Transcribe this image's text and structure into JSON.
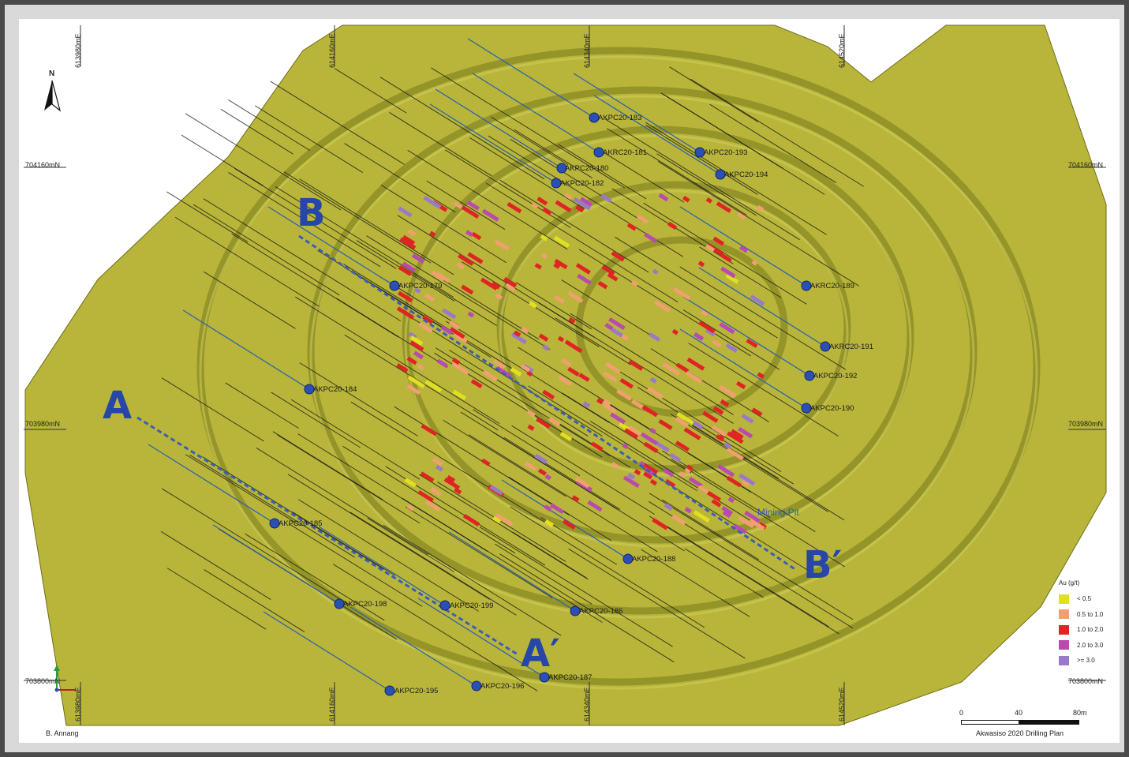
{
  "map": {
    "title": "Akwasiso 2020 Drilling Plan",
    "author": "B. Annang",
    "pit_label": "Mining Pit",
    "north_label": "N",
    "colors": {
      "terrain": "#b8b53a",
      "terrain_dark": "#8a8a22",
      "drillhole_trace": "#141414",
      "planned_trace": "#2f62a8",
      "section_line": "#3a5fb5",
      "collar": "#2a4fb5"
    },
    "eastings": [
      "613980mE",
      "614160mE",
      "614340mE",
      "614520mE"
    ],
    "northings": [
      "704160mN",
      "703980mN",
      "703800mN"
    ],
    "sections": [
      {
        "start": "A",
        "end": "A′"
      },
      {
        "start": "B",
        "end": "B′"
      }
    ],
    "drillholes": [
      "AKPC20-183",
      "AKRC20-181",
      "AKPC20-193",
      "AKPC20-180",
      "AKPC20-194",
      "AKPC20-182",
      "AKPC20-179",
      "AKRC20-189",
      "AKRC20-191",
      "AKPC20-192",
      "AKPC20-184",
      "AKPC20-190",
      "AKPC20-185",
      "AKPC20-188",
      "AKPC20-198",
      "AKPC20-199",
      "AKPC20-186",
      "AKPC20-187",
      "AKPC20-196",
      "AKPC20-195"
    ]
  },
  "legend": {
    "title": "Au (g/t)",
    "items": [
      {
        "label": "< 0.5",
        "color": "#e0e020"
      },
      {
        "label": "0.5 to 1.0",
        "color": "#f0a070"
      },
      {
        "label": "1.0 to 2.0",
        "color": "#e02424"
      },
      {
        "label": "2.0 to 3.0",
        "color": "#b84ab0"
      },
      {
        "label": ">= 3.0",
        "color": "#9a7ac8"
      }
    ]
  },
  "scale_bar": {
    "ticks": [
      "0",
      "40",
      "80m"
    ]
  }
}
